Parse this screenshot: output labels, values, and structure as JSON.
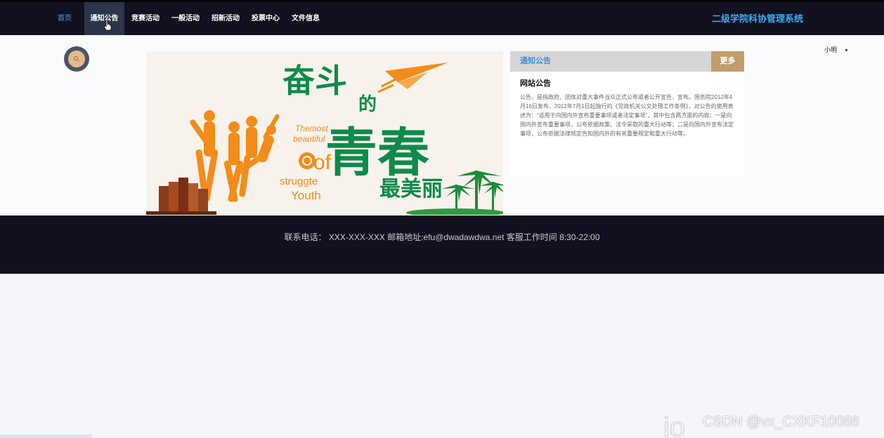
{
  "nav": {
    "items": [
      {
        "label": "首页"
      },
      {
        "label": "通知公告"
      },
      {
        "label": "竞赛活动"
      },
      {
        "label": "一般活动"
      },
      {
        "label": "招新活动"
      },
      {
        "label": "投票中心"
      },
      {
        "label": "文件信息"
      }
    ],
    "site_title": "二级学院科协管理系统"
  },
  "user": {
    "name": "小明"
  },
  "banner": {
    "heading_1": "奋斗",
    "heading_de": "的",
    "heading_2": "青春",
    "heading_3": "最美丽",
    "en_1": "Themost",
    "en_2": "beautiful",
    "en_3": "of",
    "en_4": "struggte",
    "en_5": "Youth"
  },
  "notice": {
    "header": "通知公告",
    "more": "更多",
    "subtitle": "网站公告",
    "body": "公告，是指政府、团体对重大事件当众正式公布或者公开宣告，宣布。国务院2012年4月16日发布、2012年7月1日起施行的《党政机关公文处理工作条例》，对公告的使用表述为：“适用于向国内外宣布重要事项或者法定事项”。其中包含两方面的内容：一是向国内外宣布重要事项，公布依据政策、法令采取的重大行动等；二是向国内外宣布法定事项，公布依据法律规定告知国内外的有关重要规定和重大行动等。"
  },
  "footer": {
    "text": "联系电话： XXX-XXX-XXX 邮箱地址:efu@dwadawdwa.net 客服工作时间 8:30-22:00"
  },
  "watermark": {
    "text": "CSDN @vx_CXKF10088"
  },
  "colors": {
    "nav_bg": "#11111f",
    "accent_blue": "#3fa9f5",
    "more_button": "#c39d6a",
    "banner_green": "#0f8a4a",
    "banner_orange": "#f28c1a"
  }
}
